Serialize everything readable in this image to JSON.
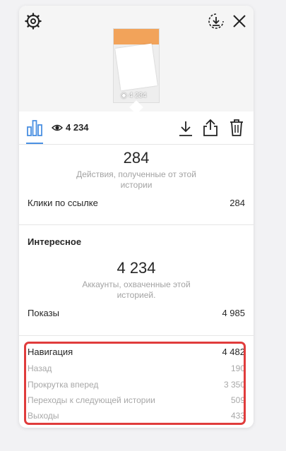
{
  "header": {
    "icons": [
      "gear-icon",
      "download-circle-icon",
      "close-icon"
    ],
    "thumbnail_views": "4 234"
  },
  "tabs": {
    "active_icon": "bar-chart-icon",
    "eye_icon": "eye-icon",
    "views": "4 234",
    "actions": [
      "download-icon",
      "share-icon",
      "trash-icon"
    ],
    "accent_color": "#4a90e2"
  },
  "actions_block": {
    "value": "284",
    "caption": "Действия, полученные от этой истории",
    "rows": [
      {
        "label": "Клики по ссылке",
        "value": "284"
      }
    ]
  },
  "interesting": {
    "title": "Интересное",
    "value": "4 234",
    "caption": "Аккаунты, охваченные этой историей.",
    "rows": [
      {
        "label": "Показы",
        "value": "4 985"
      }
    ]
  },
  "navigation": {
    "label": "Навигация",
    "value": "4 482",
    "items": [
      {
        "label": "Назад",
        "value": "190"
      },
      {
        "label": "Прокрутка вперед",
        "value": "3 350"
      },
      {
        "label": "Переходы к следующей истории",
        "value": "509"
      },
      {
        "label": "Выходы",
        "value": "433"
      }
    ],
    "highlight_color": "#e03c3c"
  }
}
